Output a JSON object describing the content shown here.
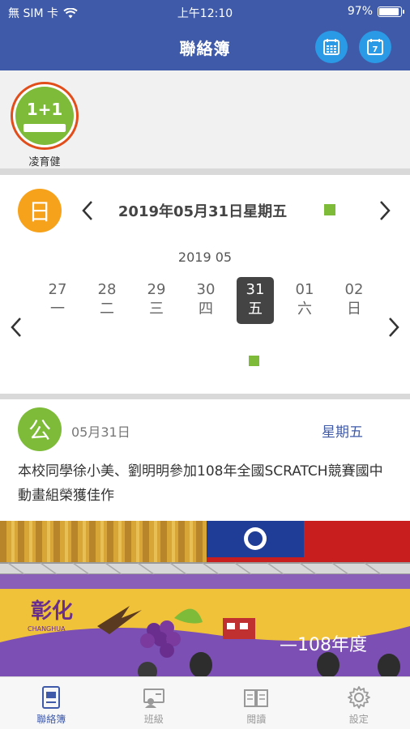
{
  "status_bar": {
    "carrier": "無 SIM 卡",
    "time": "上午12:10",
    "battery": "97%",
    "battery_level": 0.97
  },
  "header": {
    "title": "聯絡簿",
    "calendar_button_icon": "calendar-grid-icon",
    "day_button_label": "7"
  },
  "student": {
    "name": "凌育健",
    "logo_text": "1+1"
  },
  "day_view": {
    "badge": "日",
    "date_title": "2019年05月31日星期五",
    "month_label": "2019 05",
    "days": [
      {
        "num": "27",
        "wk": "一"
      },
      {
        "num": "28",
        "wk": "二"
      },
      {
        "num": "29",
        "wk": "三"
      },
      {
        "num": "30",
        "wk": "四"
      },
      {
        "num": "31",
        "wk": "五",
        "selected": true
      },
      {
        "num": "01",
        "wk": "六"
      },
      {
        "num": "02",
        "wk": "日"
      }
    ],
    "accent_color": "#7dbb39"
  },
  "announcement": {
    "badge": "公",
    "date": "05月31日",
    "weekday": "星期五",
    "text": "本校同學徐小美、劉明明參加108年全國SCRATCH競賽國中動畫組榮獲佳作"
  },
  "photo": {
    "banner_text": "—108年度",
    "logo_text": "彰化",
    "logo_sub": "CHANGHUA"
  },
  "tabs": [
    {
      "label": "聯絡簿",
      "icon": "contact-book-icon",
      "active": true
    },
    {
      "label": "班級",
      "icon": "class-icon",
      "active": false
    },
    {
      "label": "閱讀",
      "icon": "book-icon",
      "active": false
    },
    {
      "label": "設定",
      "icon": "gear-icon",
      "active": false
    }
  ],
  "colors": {
    "primary": "#3f5aa8",
    "header_button": "#2b9ae6",
    "day_badge": "#f7a21b",
    "avatar_ring": "#e24e1b"
  }
}
